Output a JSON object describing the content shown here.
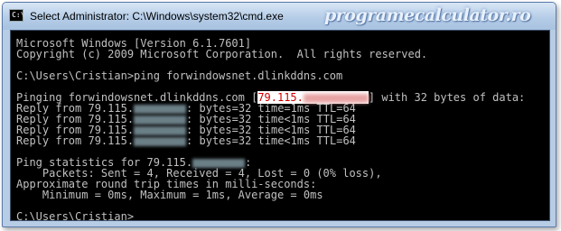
{
  "window": {
    "title": "Select Administrator: C:\\Windows\\system32\\cmd.exe",
    "icon": "cmd-icon",
    "watermark": "programecalculator.ro"
  },
  "console": {
    "lines": [
      "Microsoft Windows [Version 6.1.7601]",
      "Copyright (c) 2009 Microsoft Corporation.  All rights reserved.",
      "",
      "C:\\Users\\Cristian>ping forwindowsnet.dlinkddns.com",
      "",
      "Pinging forwindowsnet.dlinkddns.com [",
      "Reply from 79.115.",
      "Reply from 79.115.",
      "Reply from 79.115.",
      "Reply from 79.115.",
      "",
      "Ping statistics for 79.115.",
      "    Packets: Sent = 4, Received = 4, Lost = 0 (0% loss),",
      "Approximate round trip times in milli-seconds:",
      "    Minimum = 0ms, Maximum = 1ms, Average = 0ms",
      "",
      "C:\\Users\\Cristian>"
    ],
    "ping_ip_prefix": "79.115.",
    "ping_suffix": "] with 32 bytes of data:",
    "replies": [
      ": bytes=32 time=1ms TTL=64",
      ": bytes=32 time<1ms TTL=64",
      ": bytes=32 time<1ms TTL=64",
      ": bytes=32 time<1ms TTL=64"
    ],
    "stats_suffix": ":"
  },
  "colors": {
    "console_bg": "#000000",
    "console_text": "#c0c0c0",
    "highlight": "#c00000"
  }
}
